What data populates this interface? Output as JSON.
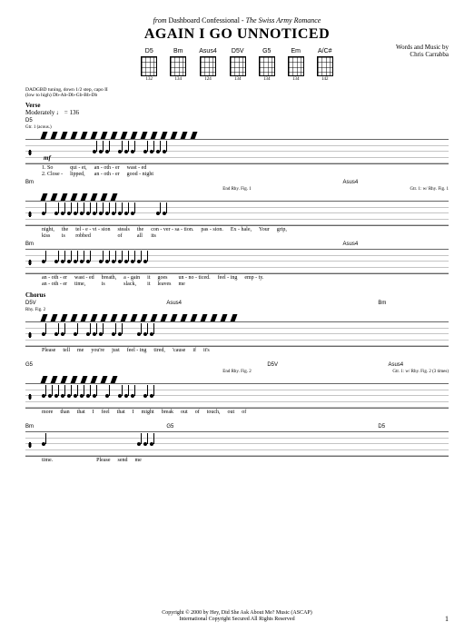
{
  "source": {
    "prefix": "from",
    "artist": "Dashboard Confessional",
    "album": "The Swiss Army Romance"
  },
  "title": "AGAIN I GO UNNOTICED",
  "credits": {
    "line1": "Words and Music by",
    "line2": "Chris Carrabba"
  },
  "chord_diagrams": [
    {
      "name": "D5",
      "fret": "132"
    },
    {
      "name": "Bm",
      "fret": "134"
    },
    {
      "name": "Asus4",
      "fret": "124"
    },
    {
      "name": "D5V",
      "fret": "134"
    },
    {
      "name": "G5",
      "fret": "134"
    },
    {
      "name": "Em",
      "fret": "134"
    },
    {
      "name": "A/C#",
      "fret": "142"
    }
  ],
  "tuning": {
    "l1": "DADGBD tuning, down 1/2 step, capo II",
    "l2": "(low to high) Db-Ab-Db-Gb-Bb-Db"
  },
  "verse": {
    "label": "Verse",
    "tempo": "Moderately ♩ = 136",
    "sys1": {
      "chords": [
        "D5"
      ],
      "rhy": "Gtr. 1 (acous.)",
      "dyn": "mf",
      "lyr1": [
        "1. So",
        "qui - et,",
        "an - oth - er",
        "wast - ed"
      ],
      "lyr2": [
        "2. Close -",
        "lipped,",
        "an - oth - er",
        "good - night"
      ]
    },
    "sys2": {
      "chords": [
        "Bm",
        "",
        "",
        "Asus4"
      ],
      "rhy": "Gtr. 1: w/ Rhy. Fig. 1",
      "end": "End Rhy. Fig. 1",
      "lyr1": [
        "night,",
        "the",
        "tel - e - vi - sion",
        "steals",
        "the",
        "con - ver - sa - tion.",
        "",
        "Ex - hale,"
      ],
      "lyr2": [
        "kiss",
        "is",
        "robbed",
        "of",
        "all",
        "its",
        "pas - sion.",
        "",
        "Your",
        "grip,"
      ]
    },
    "sys3": {
      "chords": [
        "Bm",
        "",
        "",
        "Asus4"
      ],
      "lyr1": [
        "an - oth - er",
        "wast - ed",
        "breath,",
        "a - gain",
        "it",
        "goes",
        "un - no - ticed."
      ],
      "lyr2": [
        "an - oth - er",
        "time,",
        "is",
        "slack,",
        "it",
        "leaves",
        "me",
        "feel - ing",
        "emp - ty."
      ]
    }
  },
  "chorus": {
    "label": "Chorus",
    "sys1": {
      "chords": [
        "D5V",
        "",
        "Asus4",
        "",
        "",
        "Bm"
      ],
      "rhy": "Rhy. Fig. 2",
      "lyr": [
        "Please",
        "tell",
        "me",
        "you're",
        "just",
        "feel - ing",
        "tired,",
        "'cause",
        "if",
        "it's"
      ]
    },
    "sys2": {
      "chords": [
        "G5",
        "",
        "",
        "",
        "D5V",
        "",
        "Asus4"
      ],
      "end": "End Rhy. Fig. 2",
      "rhy": "Gtr. 1: w/ Rhy. Fig. 2 (3 times)",
      "lyr": [
        "more",
        "than",
        "that",
        "I",
        "feel",
        "that",
        "I",
        "might",
        "break",
        "out",
        "of",
        "touch,",
        "out",
        "of"
      ]
    },
    "sys3": {
      "chords": [
        "Bm",
        "",
        "G5",
        "",
        "",
        "D5"
      ],
      "lyr": [
        "time.",
        "",
        "",
        "",
        "",
        "",
        "Please",
        "send",
        "me"
      ]
    }
  },
  "footer": {
    "l1": "Copyright © 2000 by Hey, Did She Ask About Me? Music (ASCAP)",
    "l2": "International Copyright Secured   All Rights Reserved"
  },
  "page": "1"
}
